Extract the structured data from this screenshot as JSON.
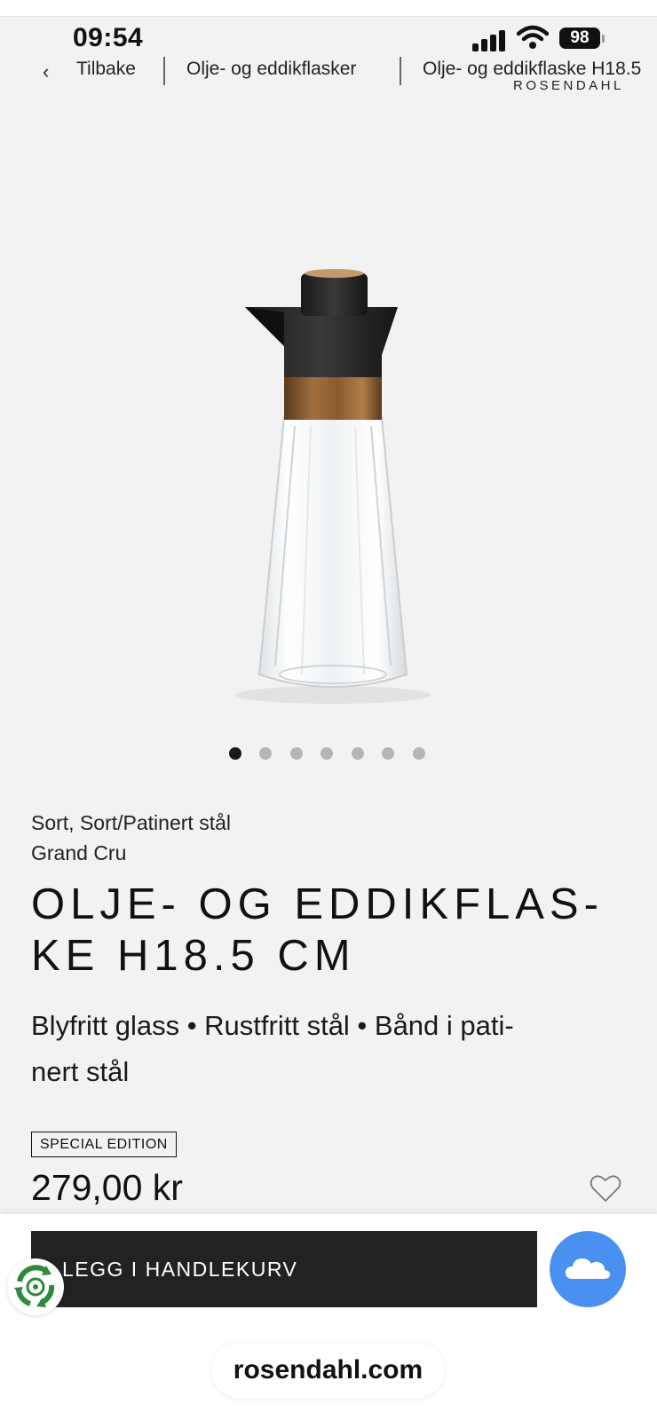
{
  "status_bar": {
    "time": "09:54",
    "battery": "98",
    "icons": [
      "signal-icon",
      "wifi-icon",
      "battery-icon"
    ]
  },
  "breadcrumb": {
    "back_label": "Tilbake",
    "items": [
      "Olje- og eddikflasker",
      "Olje- og eddikflaske H18.5"
    ]
  },
  "brand": "ROSENDAHL",
  "gallery": {
    "image_count": 7,
    "active_index": 0
  },
  "product": {
    "variant": "Sort, Sort/Patinert stål",
    "series": "Grand Cru",
    "title_line1": "OLJE- OG EDDIKFLAS-",
    "title_line2": "KE H18.5 CM",
    "materials_line1": "Blyfritt glass • Rustfritt stål • Bånd i pati-",
    "materials_line2": "nert stål",
    "badge": "SPECIAL EDITION",
    "price": "279,00 kr"
  },
  "actions": {
    "add_to_cart": "LEGG I HANDLEKURV",
    "wishlist_icon": "heart-icon",
    "cloud_icon": "cloud-icon",
    "recycle_icon": "recycle-icon"
  },
  "browser": {
    "url": "rosendahl.com"
  },
  "colors": {
    "background": "#f2f2f2",
    "cart_button": "#222222",
    "cloud_button": "#4a90f0",
    "recycle": "#2e8b3a"
  }
}
